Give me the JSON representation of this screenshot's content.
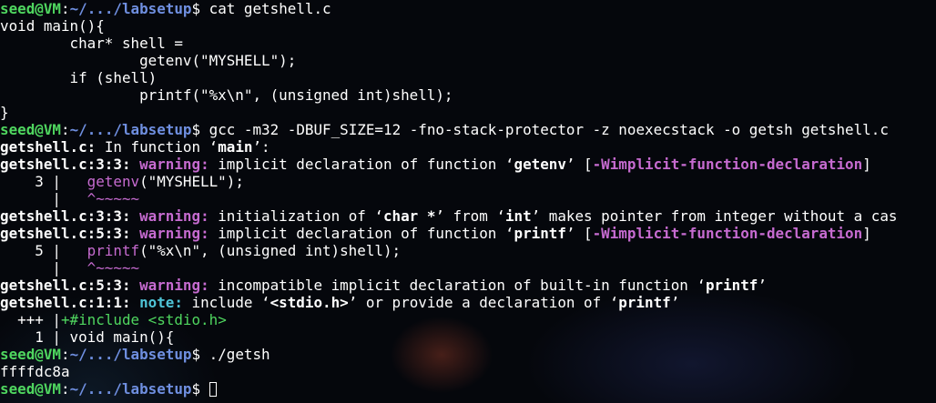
{
  "prompt": {
    "user_host": "seed@VM",
    "colon": ":",
    "path": "~/.../labsetup",
    "dollar": "$ "
  },
  "lines": [
    {
      "type": "prompt",
      "command": "cat getshell.c"
    },
    {
      "type": "plain",
      "text": "void main(){"
    },
    {
      "type": "plain",
      "text": "        char* shell ="
    },
    {
      "type": "plain",
      "text": "                getenv(\"MYSHELL\");"
    },
    {
      "type": "plain",
      "text": "        if (shell)"
    },
    {
      "type": "plain",
      "text": "                printf(\"%x\\n\", (unsigned int)shell);"
    },
    {
      "type": "plain",
      "text": "}"
    },
    {
      "type": "prompt",
      "command": "gcc -m32 -DBUF_SIZE=12 -fno-stack-protector -z noexecstack -o getsh getshell.c"
    },
    {
      "type": "diag",
      "parts": [
        {
          "s": "b",
          "t": "getshell.c:"
        },
        {
          "s": "",
          "t": " In function ‘"
        },
        {
          "s": "b",
          "t": "main"
        },
        {
          "s": "",
          "t": "’:"
        }
      ]
    },
    {
      "type": "diag",
      "parts": [
        {
          "s": "b",
          "t": "getshell.c:3:3:"
        },
        {
          "s": "",
          "t": " "
        },
        {
          "s": "w",
          "t": "warning:"
        },
        {
          "s": "",
          "t": " implicit declaration of function ‘"
        },
        {
          "s": "b",
          "t": "getenv"
        },
        {
          "s": "",
          "t": "’ ["
        },
        {
          "s": "w",
          "t": "-Wimplicit-function-declaration"
        },
        {
          "s": "",
          "t": "]"
        }
      ]
    },
    {
      "type": "diag",
      "parts": [
        {
          "s": "",
          "t": "    3 |   "
        },
        {
          "s": "m",
          "t": "getenv"
        },
        {
          "s": "",
          "t": "(\"MYSHELL\");"
        }
      ]
    },
    {
      "type": "diag",
      "parts": [
        {
          "s": "",
          "t": "      |   "
        },
        {
          "s": "m",
          "t": "^~~~~~"
        }
      ]
    },
    {
      "type": "diag",
      "parts": [
        {
          "s": "b",
          "t": "getshell.c:3:3:"
        },
        {
          "s": "",
          "t": " "
        },
        {
          "s": "w",
          "t": "warning:"
        },
        {
          "s": "",
          "t": " initialization of ‘"
        },
        {
          "s": "b",
          "t": "char *"
        },
        {
          "s": "",
          "t": "’ from ‘"
        },
        {
          "s": "b",
          "t": "int"
        },
        {
          "s": "",
          "t": "’ makes pointer from integer without a cas"
        }
      ]
    },
    {
      "type": "diag",
      "parts": [
        {
          "s": "b",
          "t": "getshell.c:5:3:"
        },
        {
          "s": "",
          "t": " "
        },
        {
          "s": "w",
          "t": "warning:"
        },
        {
          "s": "",
          "t": " implicit declaration of function ‘"
        },
        {
          "s": "b",
          "t": "printf"
        },
        {
          "s": "",
          "t": "’ ["
        },
        {
          "s": "w",
          "t": "-Wimplicit-function-declaration"
        },
        {
          "s": "",
          "t": "]"
        }
      ]
    },
    {
      "type": "diag",
      "parts": [
        {
          "s": "",
          "t": "    5 |   "
        },
        {
          "s": "m",
          "t": "printf"
        },
        {
          "s": "",
          "t": "(\"%x\\n\", (unsigned int)shell);"
        }
      ]
    },
    {
      "type": "diag",
      "parts": [
        {
          "s": "",
          "t": "      |   "
        },
        {
          "s": "m",
          "t": "^~~~~~"
        }
      ]
    },
    {
      "type": "diag",
      "parts": [
        {
          "s": "b",
          "t": "getshell.c:5:3:"
        },
        {
          "s": "",
          "t": " "
        },
        {
          "s": "w",
          "t": "warning:"
        },
        {
          "s": "",
          "t": " incompatible implicit declaration of built-in function ‘"
        },
        {
          "s": "b",
          "t": "printf"
        },
        {
          "s": "",
          "t": "’"
        }
      ]
    },
    {
      "type": "diag",
      "parts": [
        {
          "s": "b",
          "t": "getshell.c:1:1:"
        },
        {
          "s": "",
          "t": " "
        },
        {
          "s": "n",
          "t": "note:"
        },
        {
          "s": "",
          "t": " include ‘"
        },
        {
          "s": "b",
          "t": "<stdio.h>"
        },
        {
          "s": "",
          "t": "’ or provide a declaration of ‘"
        },
        {
          "s": "b",
          "t": "printf"
        },
        {
          "s": "",
          "t": "’"
        }
      ]
    },
    {
      "type": "diag",
      "parts": [
        {
          "s": "",
          "t": "  +++ |"
        },
        {
          "s": "g",
          "t": "+#include <stdio.h>"
        }
      ]
    },
    {
      "type": "plain",
      "text": "    1 | void main(){"
    },
    {
      "type": "prompt",
      "command": "./getsh"
    },
    {
      "type": "plain",
      "text": "ffffdc8a"
    },
    {
      "type": "prompt",
      "command": "",
      "cursor": true
    }
  ]
}
